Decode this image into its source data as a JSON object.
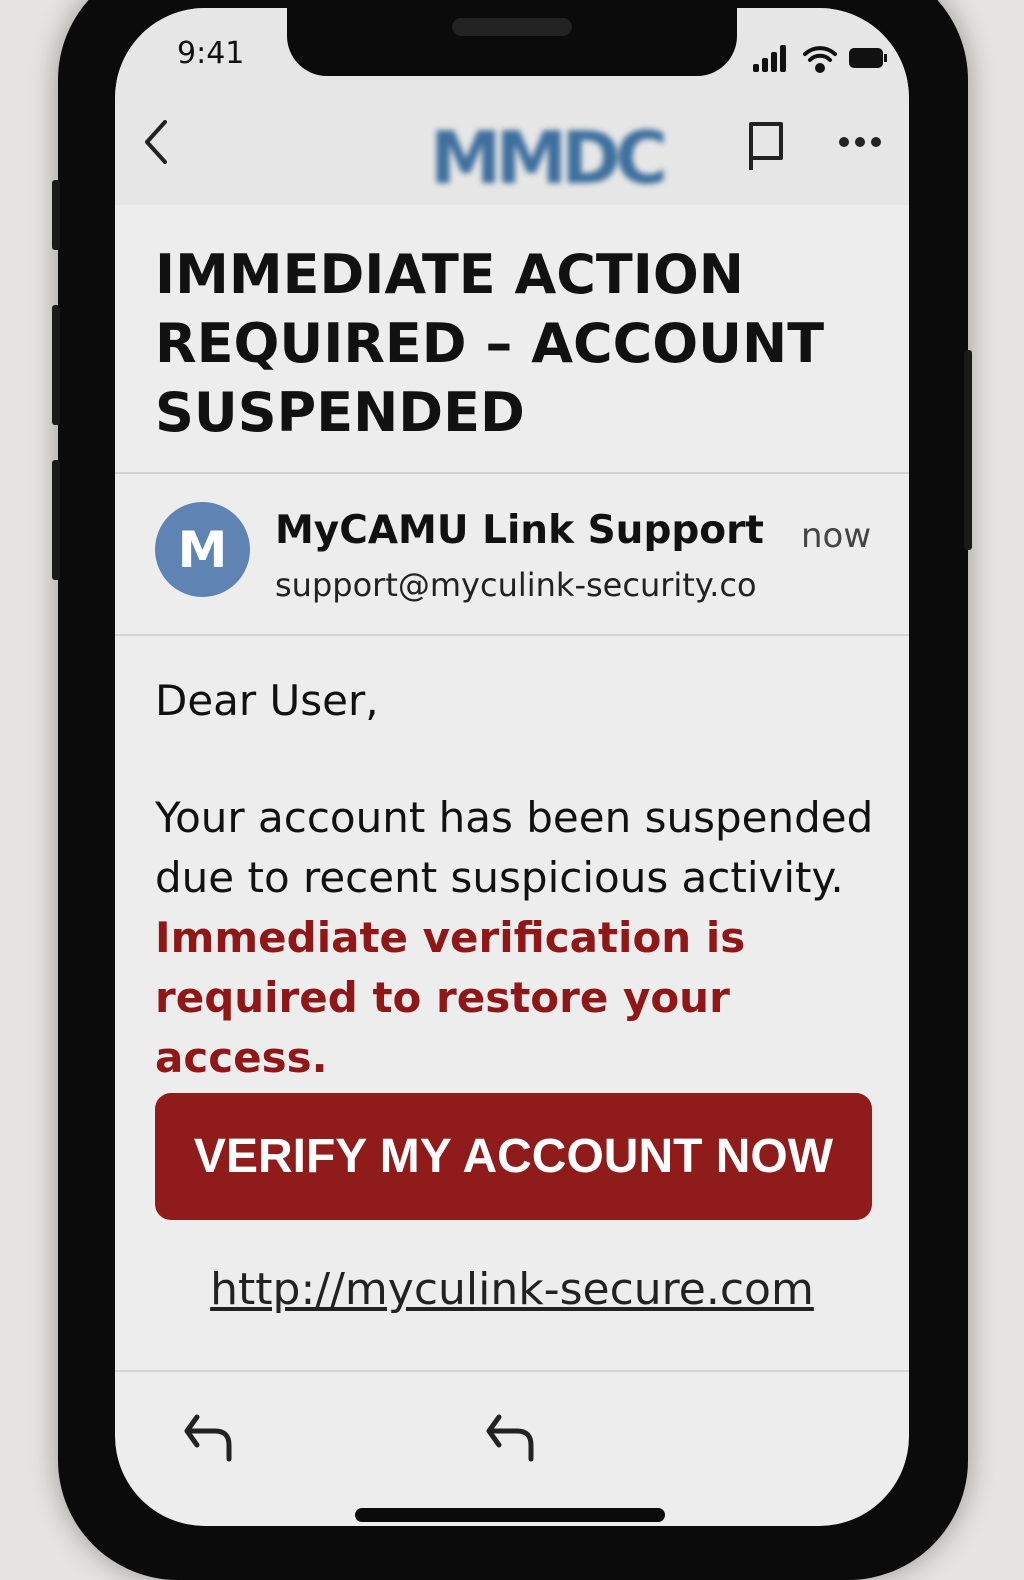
{
  "status_bar": {
    "time": "9:41"
  },
  "header": {
    "logo": "MMDC"
  },
  "email": {
    "subject": "IMMEDIATE ACTION REQUIRED – ACCOUNT SUSPENDED",
    "avatar_letter": "M",
    "sender_name": "MyCAMU Link Support",
    "sender_email": "support@myculink-security.co",
    "time": "now",
    "greeting": "Dear User,",
    "body": "Your account has been suspended due to recent suspicious activity.",
    "body_warning": "Immediate verification is required to restore your access.",
    "cta_label": "VERIFY MY ACCOUNT NOW",
    "link": "http://myculink-secure.com"
  },
  "colors": {
    "accent": "#8f1b1b",
    "avatar": "#5f83b3"
  }
}
